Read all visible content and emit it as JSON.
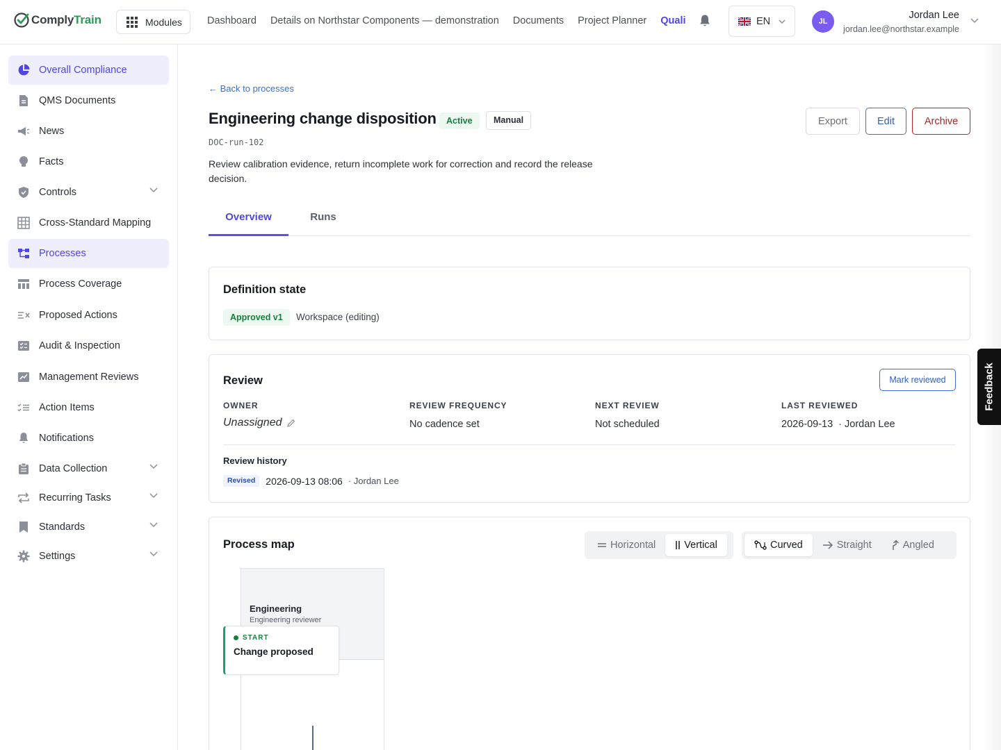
{
  "app": {
    "logo_part1": "Comply",
    "logo_part2": "Train",
    "modules_label": "Modules"
  },
  "topnav": {
    "items": [
      "Dashboard",
      "Details on Northstar Components — demonstration",
      "Documents",
      "Project Planner"
    ],
    "active": "Quali"
  },
  "language": {
    "code": "EN",
    "flag": "uk-flag-icon"
  },
  "user": {
    "initials": "JL",
    "name": "Jordan Lee",
    "email": "jordan.lee@northstar.example"
  },
  "sidebar": {
    "items": [
      {
        "label": "Overall Compliance",
        "icon": "pie-chart-icon",
        "active": true
      },
      {
        "label": "QMS Documents",
        "icon": "document-icon"
      },
      {
        "label": "News",
        "icon": "megaphone-icon"
      },
      {
        "label": "Facts",
        "icon": "lightbulb-icon"
      },
      {
        "label": "Controls",
        "icon": "shield-icon",
        "expandable": true
      },
      {
        "label": "Cross-Standard Mapping",
        "icon": "table-grid-icon"
      },
      {
        "label": "Processes",
        "icon": "process-flow-icon",
        "active": true
      },
      {
        "label": "Process Coverage",
        "icon": "coverage-table-icon"
      },
      {
        "label": "Proposed Actions",
        "icon": "list-x-icon"
      },
      {
        "label": "Audit & Inspection",
        "icon": "checklist-icon"
      },
      {
        "label": "Management Reviews",
        "icon": "chart-doc-icon"
      },
      {
        "label": "Action Items",
        "icon": "list-check-icon"
      },
      {
        "label": "Notifications",
        "icon": "bell-icon"
      },
      {
        "label": "Data Collection",
        "icon": "clipboard-icon",
        "expandable": true
      },
      {
        "label": "Recurring Tasks",
        "icon": "repeat-icon",
        "expandable": true
      },
      {
        "label": "Standards",
        "icon": "bookmark-icon",
        "expandable": true
      },
      {
        "label": "Settings",
        "icon": "gear-icon",
        "expandable": true
      }
    ]
  },
  "process": {
    "back_label": "← Back to processes",
    "title": "Engineering change disposition",
    "status": "Active",
    "mode": "Manual",
    "doc_id": "DOC-run-102",
    "description": "Review calibration evidence, return incomplete work for correction and record the release decision.",
    "actions": {
      "export": "Export",
      "edit": "Edit",
      "archive": "Archive"
    }
  },
  "tabs": {
    "overview": "Overview",
    "runs": "Runs"
  },
  "definition": {
    "title": "Definition state",
    "approved": "Approved v1",
    "workspace": "Workspace (editing)"
  },
  "review": {
    "title": "Review",
    "mark_label": "Mark reviewed",
    "owner_label": "OWNER",
    "owner_value": "Unassigned",
    "frequency_label": "REVIEW FREQUENCY",
    "frequency_value": "No cadence set",
    "next_label": "NEXT REVIEW",
    "next_value": "Not scheduled",
    "last_label": "LAST REVIEWED",
    "last_date": "2026-09-13",
    "last_user": "· Jordan Lee",
    "history_title": "Review history",
    "history": [
      {
        "tag": "Revised",
        "date": "2026-09-13 08:06",
        "user": "· Jordan Lee"
      }
    ]
  },
  "process_map": {
    "title": "Process map",
    "orientation": {
      "horizontal": "Horizontal",
      "vertical": "Vertical",
      "selected": "vertical"
    },
    "edges": {
      "curved": "Curved",
      "straight": "Straight",
      "angled": "Angled",
      "selected": "curved"
    },
    "lane": {
      "name": "Engineering",
      "role": "Engineering reviewer"
    },
    "node": {
      "kind": "START",
      "label": "Change proposed"
    }
  },
  "feedback_label": "Feedback",
  "colors": {
    "accent": "#4f46e5",
    "link": "#3b6fd6",
    "success": "#15803d",
    "danger": "#b42323",
    "avatar": "#7b5cf0"
  }
}
